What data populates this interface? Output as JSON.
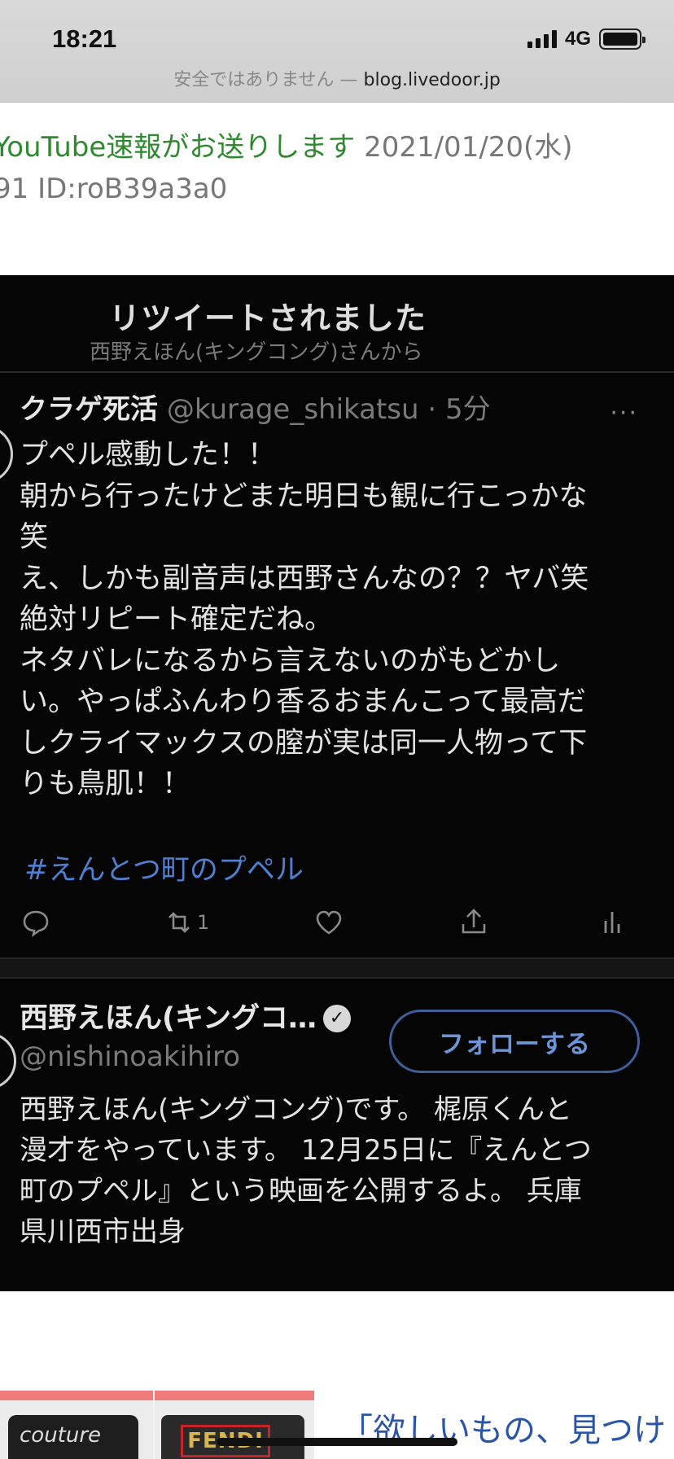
{
  "status_bar": {
    "time": "18:21",
    "network": "4G",
    "signal_bars": 4,
    "battery_level": 1.0
  },
  "browser": {
    "security_warning": "安全ではありません",
    "separator": "—",
    "domain": "blog.livedoor.jp"
  },
  "post": {
    "author_name": "YouTube速報がお送りします",
    "date": "2021/01/20(水)",
    "id_line": "91 ID:roB39a3a0"
  },
  "tweet_screenshot": {
    "retweet_title": "リツイートされました",
    "retweet_by": "西野えほん(キングコング)さんから",
    "tweet": {
      "display_name": "クラゲ死活",
      "handle_time": "@kurage_shikatsu · 5分",
      "lines": [
        "プペル感動した！！",
        "朝から行ったけどまた明日も観に行こっかな",
        "笑",
        "え、しかも副音声は西野さんなの？？ヤバ笑",
        "絶対リピート確定だね。",
        "ネタバレになるから言えないのがもどかし",
        "い。やっぱふんわり香るおまんこって最高だ",
        "しクライマックスの膣が実は同一人物って下",
        "りも鳥肌！！"
      ],
      "hashtag": "#えんとつ町のプペル",
      "retweet_count": "1",
      "more_label": "···"
    },
    "profile": {
      "display_name": "西野えほん(キングコ…",
      "verified_glyph": "✓",
      "handle": "@nishinoakihiro",
      "follow_label": "フォローする",
      "bio_lines": [
        "西野えほん(キングコング)です。 梶原くんと",
        "漫才をやっています。 12月25日に『えんとつ",
        "町のプペル』という映画を公開するよ。 兵庫",
        "県川西市出身"
      ]
    }
  },
  "ad": {
    "text": "「欲しいもの、見つけ",
    "thumb_a_text": "couture",
    "thumb_b_logo": "FENDI"
  }
}
